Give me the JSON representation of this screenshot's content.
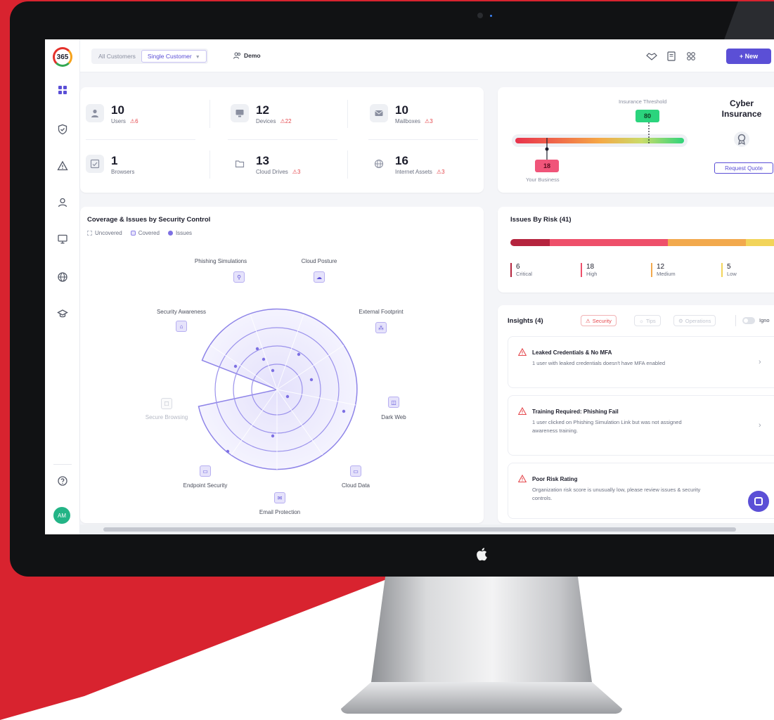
{
  "topbar": {
    "segments": [
      "All Customers",
      "Single Customer"
    ],
    "demo_label": "Demo",
    "new_label": "+ New"
  },
  "sidebar": {
    "logo_text": "365",
    "avatar_initials": "AM"
  },
  "stats": [
    {
      "value": "10",
      "label": "Users",
      "alert": "6"
    },
    {
      "value": "12",
      "label": "Devices",
      "alert": "22"
    },
    {
      "value": "10",
      "label": "Mailboxes",
      "alert": "3"
    },
    {
      "value": "1",
      "label": "Browsers",
      "alert": ""
    },
    {
      "value": "13",
      "label": "Cloud Drives",
      "alert": "3"
    },
    {
      "value": "16",
      "label": "Internet Assets",
      "alert": "3"
    }
  ],
  "insurance": {
    "threshold_label": "Insurance Threshold",
    "threshold_value": "80",
    "business_value": "18",
    "business_label": "Your Business",
    "title_line1": "Cyber",
    "title_line2": "Insurance",
    "request_label": "Request Quote"
  },
  "coverage": {
    "title": "Coverage & Issues by Security Control",
    "legend": [
      "Uncovered",
      "Covered",
      "Issues"
    ],
    "controls": {
      "phishing": "Phishing Simulations",
      "cloud_posture": "Cloud Posture",
      "external": "External Footprint",
      "awareness": "Security Awareness",
      "dark_web": "Dark Web",
      "browsing": "Secure Browsing",
      "cloud_data": "Cloud Data",
      "endpoint": "Endpoint Security",
      "email": "Email Protection"
    }
  },
  "issues": {
    "title": "Issues By Risk (41)",
    "levels": [
      {
        "count": "6",
        "label": "Critical",
        "color": "#b5243e"
      },
      {
        "count": "18",
        "label": "High",
        "color": "#ee4f6a"
      },
      {
        "count": "12",
        "label": "Medium",
        "color": "#f2a94d"
      },
      {
        "count": "5",
        "label": "Low",
        "color": "#f2d45a"
      }
    ]
  },
  "insights": {
    "title": "Insights (4)",
    "filters": [
      "Security",
      "Tips",
      "Operations"
    ],
    "ignore_label": "Igno",
    "items": [
      {
        "title": "Leaked Credentials & No MFA",
        "desc": "1 user with leaked credentials doesn't have MFA enabled"
      },
      {
        "title": "Training Required: Phishing Fail",
        "desc_line1": "1 user clicked on Phishing Simulation Link but was not assigned",
        "desc_line2": "awareness training."
      },
      {
        "title": "Poor Risk Rating",
        "desc_line1": "Organization risk score is unusually low, please review issues & security",
        "desc_line2": "controls."
      }
    ]
  },
  "colors": {
    "accent": "#5b4fd6",
    "alert": "#e5484d",
    "threshold": "#2bd47d",
    "business": "#f0557a"
  },
  "icons": [
    "grid-icon",
    "shield-icon",
    "warning-icon",
    "user-icon",
    "monitor-icon",
    "globe-icon",
    "graduation-cap-icon",
    "help-icon",
    "users-icon",
    "book-icon",
    "handshake-icon"
  ]
}
